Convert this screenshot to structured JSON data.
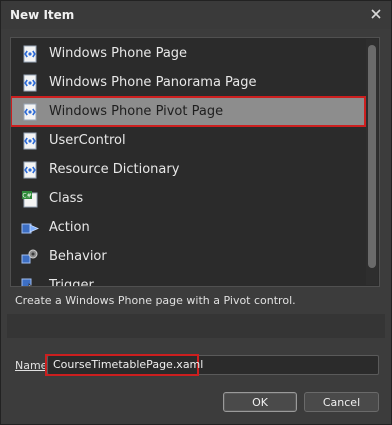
{
  "window": {
    "title": "New Item",
    "close_icon": "close-icon"
  },
  "items": [
    {
      "label": "Windows Phone Page",
      "icon": "xaml-page-icon",
      "selected": false
    },
    {
      "label": "Windows Phone Panorama Page",
      "icon": "xaml-page-icon",
      "selected": false
    },
    {
      "label": "Windows Phone Pivot Page",
      "icon": "xaml-page-icon",
      "selected": true
    },
    {
      "label": "UserControl",
      "icon": "xaml-page-icon",
      "selected": false
    },
    {
      "label": "Resource Dictionary",
      "icon": "xaml-page-icon",
      "selected": false
    },
    {
      "label": "Class",
      "icon": "csharp-class-icon",
      "selected": false
    },
    {
      "label": "Action",
      "icon": "action-icon",
      "selected": false
    },
    {
      "label": "Behavior",
      "icon": "behavior-icon",
      "selected": false
    },
    {
      "label": "Trigger",
      "icon": "trigger-icon",
      "selected": false
    }
  ],
  "description": "Create a Windows Phone page with a Pivot control.",
  "name_field": {
    "label": "Name",
    "value": "CourseTimetablePage.xaml"
  },
  "buttons": {
    "ok": "OK",
    "cancel": "Cancel"
  },
  "colors": {
    "background": "#3c3c3c",
    "list_background": "#2b2b2b",
    "selection": "#8d8d8d",
    "highlight_border": "#cc1f1f"
  }
}
